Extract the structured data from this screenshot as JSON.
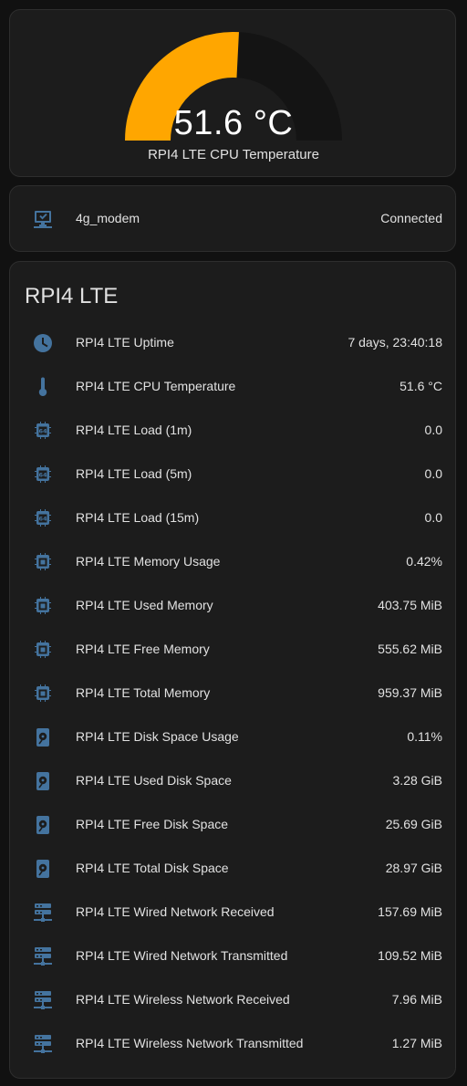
{
  "gauge": {
    "value_text": "51.6 °C",
    "name": "RPI4 LTE CPU Temperature",
    "value": 51.6,
    "fraction": 0.516,
    "fill_color": "#ffa600",
    "track_color": "#141414"
  },
  "modem": {
    "icon": "monitor-check-icon",
    "label": "4g_modem",
    "value": "Connected"
  },
  "system": {
    "title": "RPI4 LTE",
    "icon_color": "#44739e",
    "rows": [
      {
        "icon": "clock-icon",
        "label": "RPI4 LTE Uptime",
        "value": "7 days, 23:40:18"
      },
      {
        "icon": "thermometer-icon",
        "label": "RPI4 LTE CPU Temperature",
        "value": "51.6 °C"
      },
      {
        "icon": "cpu-64-icon",
        "label": "RPI4 LTE Load (1m)",
        "value": "0.0"
      },
      {
        "icon": "cpu-64-icon",
        "label": "RPI4 LTE Load (5m)",
        "value": "0.0"
      },
      {
        "icon": "cpu-64-icon",
        "label": "RPI4 LTE Load (15m)",
        "value": "0.0"
      },
      {
        "icon": "memory-chip-icon",
        "label": "RPI4 LTE Memory Usage",
        "value": "0.42%"
      },
      {
        "icon": "memory-chip-icon",
        "label": "RPI4 LTE Used Memory",
        "value": "403.75 MiB"
      },
      {
        "icon": "memory-chip-icon",
        "label": "RPI4 LTE Free Memory",
        "value": "555.62 MiB"
      },
      {
        "icon": "memory-chip-icon",
        "label": "RPI4 LTE Total Memory",
        "value": "959.37 MiB"
      },
      {
        "icon": "harddisk-icon",
        "label": "RPI4 LTE Disk Space Usage",
        "value": "0.11%"
      },
      {
        "icon": "harddisk-icon",
        "label": "RPI4 LTE Used Disk Space",
        "value": "3.28 GiB"
      },
      {
        "icon": "harddisk-icon",
        "label": "RPI4 LTE Free Disk Space",
        "value": "25.69 GiB"
      },
      {
        "icon": "harddisk-icon",
        "label": "RPI4 LTE Total Disk Space",
        "value": "28.97 GiB"
      },
      {
        "icon": "server-network-icon",
        "label": "RPI4 LTE Wired Network Received",
        "value": "157.69 MiB"
      },
      {
        "icon": "server-network-icon",
        "label": "RPI4 LTE Wired Network Transmitted",
        "value": "109.52 MiB"
      },
      {
        "icon": "server-network-icon",
        "label": "RPI4 LTE Wireless Network Received",
        "value": "7.96 MiB"
      },
      {
        "icon": "server-network-icon",
        "label": "RPI4 LTE Wireless Network Transmitted",
        "value": "1.27 MiB"
      }
    ]
  }
}
